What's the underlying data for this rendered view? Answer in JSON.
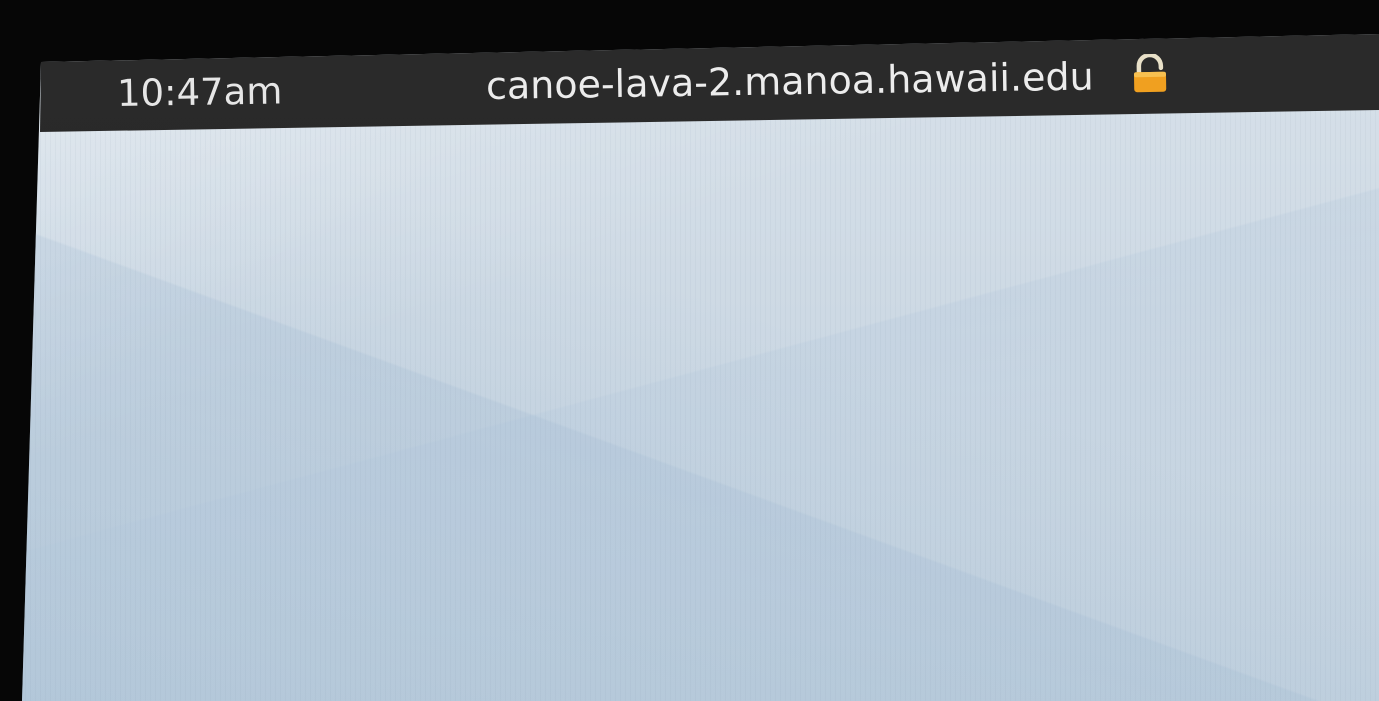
{
  "status_bar": {
    "clock": "10:47am",
    "hostname": "canoe-lava-2.manoa.hawaii.edu",
    "lock_icon": "lock-icon",
    "lock_color": "#f0a020",
    "background": "#262626"
  },
  "desktop": {
    "wallpaper_color": "#cdd9e4"
  }
}
